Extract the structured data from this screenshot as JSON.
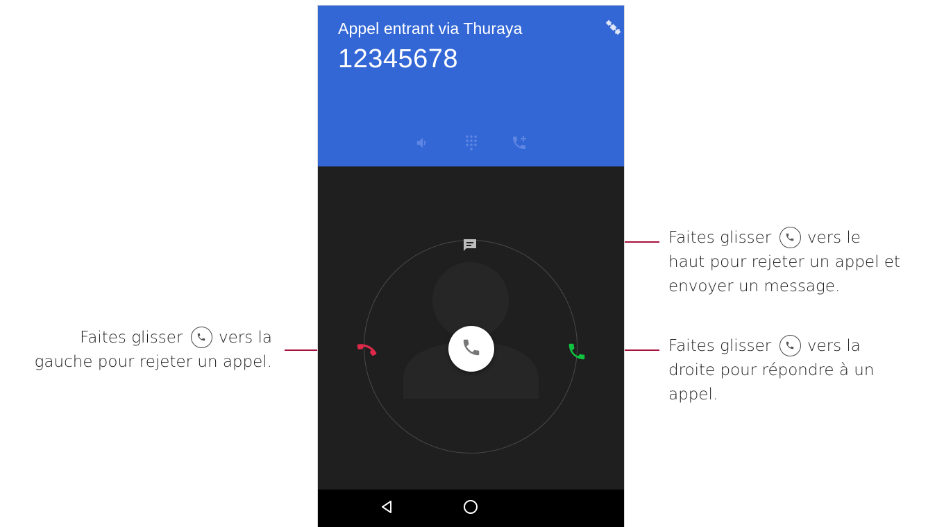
{
  "call": {
    "title": "Appel entrant via Thuraya",
    "number": "12345678"
  },
  "header_actions": [
    {
      "icon": "speaker-icon"
    },
    {
      "icon": "dialpad-icon"
    },
    {
      "icon": "add-call-icon"
    }
  ],
  "targets": {
    "message": {
      "icon": "message-icon"
    },
    "reject": {
      "icon": "decline-call-icon",
      "color": "#e0294a"
    },
    "answer": {
      "icon": "accept-call-icon",
      "color": "#10c23f"
    }
  },
  "colors": {
    "header_bg": "#3467d6",
    "body_bg": "#1f1f1f",
    "leader_line": "#a6113d"
  },
  "callouts": {
    "message": {
      "prefix": "Faites glisser",
      "line1_suffix": "vers le",
      "line2": "haut pour rejeter un appel et",
      "line3": "envoyer un message."
    },
    "reject": {
      "prefix": "Faites glisser",
      "line1_suffix": "vers la",
      "line2": "gauche pour rejeter un appel."
    },
    "answer": {
      "prefix": "Faites glisser",
      "line1_suffix": "vers la",
      "line2": "droite pour répondre à un",
      "line3": "appel."
    }
  },
  "nav": [
    {
      "icon": "back-icon"
    },
    {
      "icon": "home-icon"
    }
  ]
}
